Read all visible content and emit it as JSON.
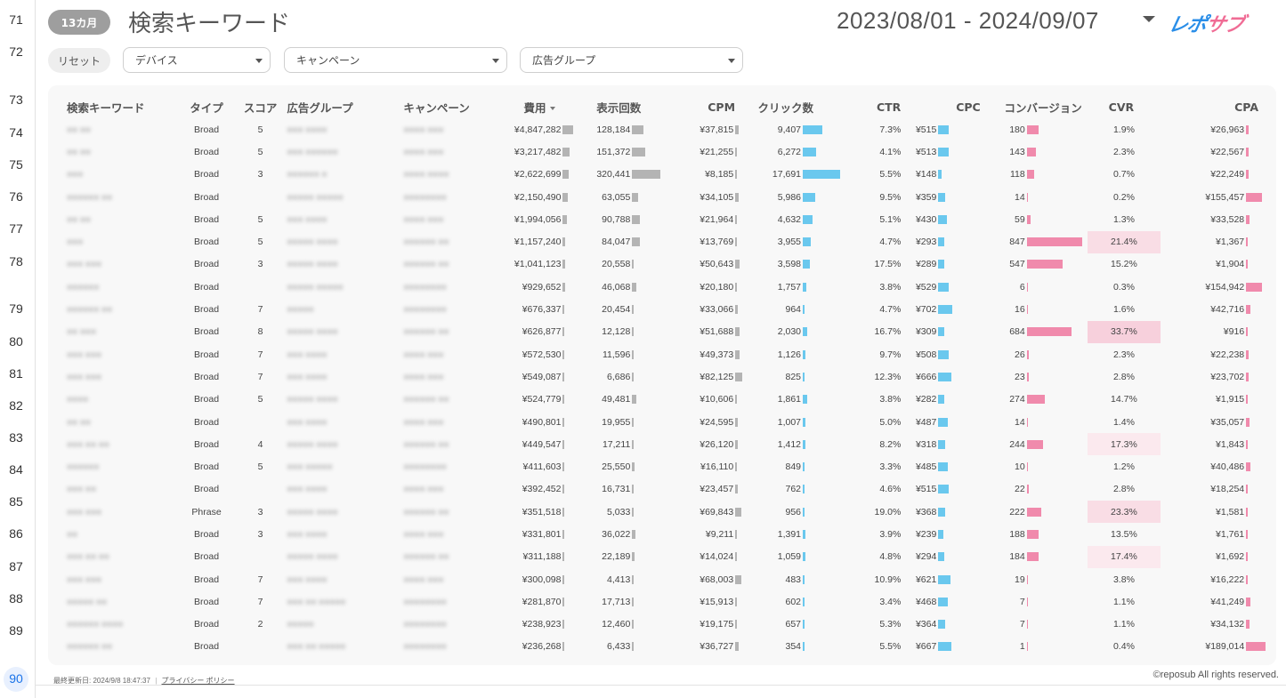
{
  "gutter": {
    "rows": [
      "71",
      "72",
      "73",
      "74",
      "75",
      "76",
      "77",
      "78",
      "79",
      "80",
      "81",
      "82",
      "83",
      "84",
      "85",
      "86",
      "87",
      "88",
      "89",
      "90"
    ],
    "active_row": "90"
  },
  "header": {
    "period_label": "13カ月",
    "title": "検索キーワード",
    "date_range": "2023/08/01 - 2024/09/07",
    "logo_text_main": "レポ",
    "logo_text_accent": "サブ"
  },
  "filters": {
    "reset_label": "リセット",
    "device_label": "デバイス",
    "campaign_label": "キャンペーン",
    "adgroup_label": "広告グループ"
  },
  "table": {
    "columns": [
      "検索キーワード",
      "タイプ",
      "スコア",
      "広告グループ",
      "キャンペーン",
      "費用",
      "表示回数",
      "CPM",
      "クリック数",
      "CTR",
      "CPC",
      "コンバージョン",
      "CVR",
      "CPA"
    ],
    "sort_column": "費用",
    "rows": [
      {
        "kw": "■■ ■■",
        "type": "Broad",
        "score": "5",
        "ag": "■■■ ■■■■",
        "camp": "■■■■ ■■■",
        "cost": "¥4,847,282",
        "cost_r": 1.0,
        "imp": "128,184",
        "imp_r": 0.4,
        "cpm": "¥37,815",
        "cpm_r": 0.46,
        "clk": "9,407",
        "clk_r": 0.53,
        "ctr": "7.3%",
        "cpc": "¥515",
        "cpc_r": 0.72,
        "cv": "180",
        "cv_r": 0.21,
        "cvr": "1.9%",
        "cvr_level": 0,
        "cpa": "¥26,963",
        "cpa_r": 0.14
      },
      {
        "kw": "■■ ■■",
        "type": "Broad",
        "score": "5",
        "ag": "■■■ ■■■■■■",
        "camp": "■■■■ ■■■",
        "cost": "¥3,217,482",
        "cost_r": 0.66,
        "imp": "151,372",
        "imp_r": 0.47,
        "cpm": "¥21,255",
        "cpm_r": 0.26,
        "clk": "6,272",
        "clk_r": 0.35,
        "ctr": "4.1%",
        "cpc": "¥513",
        "cpc_r": 0.72,
        "cv": "143",
        "cv_r": 0.17,
        "cvr": "2.3%",
        "cvr_level": 0,
        "cpa": "¥22,567",
        "cpa_r": 0.12
      },
      {
        "kw": "■■■",
        "type": "Broad",
        "score": "3",
        "ag": "■■■■■■ ■",
        "camp": "■■■■ ■■■■",
        "cost": "¥2,622,699",
        "cost_r": 0.54,
        "imp": "320,441",
        "imp_r": 1.0,
        "cpm": "¥8,185",
        "cpm_r": 0.1,
        "clk": "17,691",
        "clk_r": 1.0,
        "ctr": "5.5%",
        "cpc": "¥148",
        "cpc_r": 0.21,
        "cv": "118",
        "cv_r": 0.14,
        "cvr": "0.7%",
        "cvr_level": 0,
        "cpa": "¥22,249",
        "cpa_r": 0.12
      },
      {
        "kw": "■■■■■■ ■■",
        "type": "Broad",
        "score": "",
        "ag": "■■■■■ ■■■■■",
        "camp": "■■■■■■■■",
        "cost": "¥2,150,490",
        "cost_r": 0.44,
        "imp": "63,055",
        "imp_r": 0.2,
        "cpm": "¥34,105",
        "cpm_r": 0.42,
        "clk": "5,986",
        "clk_r": 0.34,
        "ctr": "9.5%",
        "cpc": "¥359",
        "cpc_r": 0.5,
        "cv": "14",
        "cv_r": 0.02,
        "cvr": "0.2%",
        "cvr_level": 0,
        "cpa": "¥155,457",
        "cpa_r": 0.82
      },
      {
        "kw": "■■ ■■",
        "type": "Broad",
        "score": "5",
        "ag": "■■■ ■■■■",
        "camp": "■■■■ ■■■",
        "cost": "¥1,994,056",
        "cost_r": 0.41,
        "imp": "90,788",
        "imp_r": 0.28,
        "cpm": "¥21,964",
        "cpm_r": 0.27,
        "clk": "4,632",
        "clk_r": 0.26,
        "ctr": "5.1%",
        "cpc": "¥430",
        "cpc_r": 0.6,
        "cv": "59",
        "cv_r": 0.07,
        "cvr": "1.3%",
        "cvr_level": 0,
        "cpa": "¥33,528",
        "cpa_r": 0.18
      },
      {
        "kw": "■■■",
        "type": "Broad",
        "score": "5",
        "ag": "■■■■■ ■■■■",
        "camp": "■■■■■■ ■■",
        "cost": "¥1,157,240",
        "cost_r": 0.24,
        "imp": "84,047",
        "imp_r": 0.26,
        "cpm": "¥13,769",
        "cpm_r": 0.17,
        "clk": "3,955",
        "clk_r": 0.22,
        "ctr": "4.7%",
        "cpc": "¥293",
        "cpc_r": 0.41,
        "cv": "847",
        "cv_r": 1.0,
        "cvr": "21.4%",
        "cvr_level": 2,
        "cpa": "¥1,367",
        "cpa_r": 0.01
      },
      {
        "kw": "■■■ ■■■",
        "type": "Broad",
        "score": "3",
        "ag": "■■■■■ ■■■■",
        "camp": "■■■■■■ ■■",
        "cost": "¥1,041,123",
        "cost_r": 0.21,
        "imp": "20,558",
        "imp_r": 0.06,
        "cpm": "¥50,643",
        "cpm_r": 0.62,
        "clk": "3,598",
        "clk_r": 0.2,
        "ctr": "17.5%",
        "cpc": "¥289",
        "cpc_r": 0.41,
        "cv": "547",
        "cv_r": 0.65,
        "cvr": "15.2%",
        "cvr_level": 0,
        "cpa": "¥1,904",
        "cpa_r": 0.01
      },
      {
        "kw": "■■■■■■",
        "type": "Broad",
        "score": "",
        "ag": "■■■■■ ■■■■■",
        "camp": "■■■■■■■■",
        "cost": "¥929,652",
        "cost_r": 0.19,
        "imp": "46,068",
        "imp_r": 0.14,
        "cpm": "¥20,180",
        "cpm_r": 0.25,
        "clk": "1,757",
        "clk_r": 0.1,
        "ctr": "3.8%",
        "cpc": "¥529",
        "cpc_r": 0.74,
        "cv": "6",
        "cv_r": 0.01,
        "cvr": "0.3%",
        "cvr_level": 0,
        "cpa": "¥154,942",
        "cpa_r": 0.82
      },
      {
        "kw": "■■■■■■ ■■",
        "type": "Broad",
        "score": "7",
        "ag": "■■■■■",
        "camp": "■■■■■■■■",
        "cost": "¥676,337",
        "cost_r": 0.14,
        "imp": "20,454",
        "imp_r": 0.06,
        "cpm": "¥33,066",
        "cpm_r": 0.4,
        "clk": "964",
        "clk_r": 0.05,
        "ctr": "4.7%",
        "cpc": "¥702",
        "cpc_r": 0.98,
        "cv": "16",
        "cv_r": 0.02,
        "cvr": "1.6%",
        "cvr_level": 0,
        "cpa": "¥42,716",
        "cpa_r": 0.23
      },
      {
        "kw": "■■ ■■■",
        "type": "Broad",
        "score": "8",
        "ag": "■■■■■ ■■■■",
        "camp": "■■■■■■ ■■",
        "cost": "¥626,877",
        "cost_r": 0.13,
        "imp": "12,128",
        "imp_r": 0.04,
        "cpm": "¥51,688",
        "cpm_r": 0.63,
        "clk": "2,030",
        "clk_r": 0.11,
        "ctr": "16.7%",
        "cpc": "¥309",
        "cpc_r": 0.43,
        "cv": "684",
        "cv_r": 0.81,
        "cvr": "33.7%",
        "cvr_level": 3,
        "cpa": "¥916",
        "cpa_r": 0.0
      },
      {
        "kw": "■■■ ■■■",
        "type": "Broad",
        "score": "7",
        "ag": "■■■ ■■■■",
        "camp": "■■■■ ■■■",
        "cost": "¥572,530",
        "cost_r": 0.12,
        "imp": "11,596",
        "imp_r": 0.04,
        "cpm": "¥49,373",
        "cpm_r": 0.6,
        "clk": "1,126",
        "clk_r": 0.06,
        "ctr": "9.7%",
        "cpc": "¥508",
        "cpc_r": 0.71,
        "cv": "26",
        "cv_r": 0.03,
        "cvr": "2.3%",
        "cvr_level": 0,
        "cpa": "¥22,238",
        "cpa_r": 0.12
      },
      {
        "kw": "■■■ ■■■",
        "type": "Broad",
        "score": "7",
        "ag": "■■■ ■■■■",
        "camp": "■■■■ ■■■",
        "cost": "¥549,087",
        "cost_r": 0.11,
        "imp": "6,686",
        "imp_r": 0.02,
        "cpm": "¥82,125",
        "cpm_r": 1.0,
        "clk": "825",
        "clk_r": 0.05,
        "ctr": "12.3%",
        "cpc": "¥666",
        "cpc_r": 0.93,
        "cv": "23",
        "cv_r": 0.03,
        "cvr": "2.8%",
        "cvr_level": 0,
        "cpa": "¥23,702",
        "cpa_r": 0.13
      },
      {
        "kw": "■■■■",
        "type": "Broad",
        "score": "5",
        "ag": "■■■■■ ■■■■",
        "camp": "■■■■■■ ■■",
        "cost": "¥524,779",
        "cost_r": 0.11,
        "imp": "49,481",
        "imp_r": 0.15,
        "cpm": "¥10,606",
        "cpm_r": 0.13,
        "clk": "1,861",
        "clk_r": 0.11,
        "ctr": "3.8%",
        "cpc": "¥282",
        "cpc_r": 0.39,
        "cv": "274",
        "cv_r": 0.32,
        "cvr": "14.7%",
        "cvr_level": 0,
        "cpa": "¥1,915",
        "cpa_r": 0.01
      },
      {
        "kw": "■■ ■■",
        "type": "Broad",
        "score": "",
        "ag": "■■■ ■■■■",
        "camp": "■■■■ ■■■",
        "cost": "¥490,801",
        "cost_r": 0.1,
        "imp": "19,955",
        "imp_r": 0.06,
        "cpm": "¥24,595",
        "cpm_r": 0.3,
        "clk": "1,007",
        "clk_r": 0.06,
        "ctr": "5.0%",
        "cpc": "¥487",
        "cpc_r": 0.68,
        "cv": "14",
        "cv_r": 0.02,
        "cvr": "1.4%",
        "cvr_level": 0,
        "cpa": "¥35,057",
        "cpa_r": 0.18
      },
      {
        "kw": "■■■ ■■ ■■",
        "type": "Broad",
        "score": "4",
        "ag": "■■■■■ ■■■■",
        "camp": "■■■■■■ ■■",
        "cost": "¥449,547",
        "cost_r": 0.09,
        "imp": "17,211",
        "imp_r": 0.05,
        "cpm": "¥26,120",
        "cpm_r": 0.32,
        "clk": "1,412",
        "clk_r": 0.08,
        "ctr": "8.2%",
        "cpc": "¥318",
        "cpc_r": 0.45,
        "cv": "244",
        "cv_r": 0.29,
        "cvr": "17.3%",
        "cvr_level": 1,
        "cpa": "¥1,843",
        "cpa_r": 0.01
      },
      {
        "kw": "■■■■■■",
        "type": "Broad",
        "score": "5",
        "ag": "■■■ ■■■■■",
        "camp": "■■■■■■■■",
        "cost": "¥411,603",
        "cost_r": 0.08,
        "imp": "25,550",
        "imp_r": 0.08,
        "cpm": "¥16,110",
        "cpm_r": 0.2,
        "clk": "849",
        "clk_r": 0.05,
        "ctr": "3.3%",
        "cpc": "¥485",
        "cpc_r": 0.68,
        "cv": "10",
        "cv_r": 0.01,
        "cvr": "1.2%",
        "cvr_level": 0,
        "cpa": "¥40,486",
        "cpa_r": 0.21
      },
      {
        "kw": "■■■ ■■",
        "type": "Broad",
        "score": "",
        "ag": "■■■ ■■■■",
        "camp": "■■■■ ■■■",
        "cost": "¥392,452",
        "cost_r": 0.08,
        "imp": "16,731",
        "imp_r": 0.05,
        "cpm": "¥23,457",
        "cpm_r": 0.29,
        "clk": "762",
        "clk_r": 0.04,
        "ctr": "4.6%",
        "cpc": "¥515",
        "cpc_r": 0.72,
        "cv": "22",
        "cv_r": 0.03,
        "cvr": "2.8%",
        "cvr_level": 0,
        "cpa": "¥18,254",
        "cpa_r": 0.1
      },
      {
        "kw": "■■■ ■■■",
        "type": "Phrase",
        "score": "3",
        "ag": "■■■■■ ■■■■",
        "camp": "■■■■■■ ■■",
        "cost": "¥351,518",
        "cost_r": 0.07,
        "imp": "5,033",
        "imp_r": 0.02,
        "cpm": "¥69,843",
        "cpm_r": 0.85,
        "clk": "956",
        "clk_r": 0.05,
        "ctr": "19.0%",
        "cpc": "¥368",
        "cpc_r": 0.51,
        "cv": "222",
        "cv_r": 0.26,
        "cvr": "23.3%",
        "cvr_level": 2,
        "cpa": "¥1,581",
        "cpa_r": 0.01
      },
      {
        "kw": "■■",
        "type": "Broad",
        "score": "3",
        "ag": "■■■ ■■■■",
        "camp": "■■■■ ■■■",
        "cost": "¥331,801",
        "cost_r": 0.07,
        "imp": "36,022",
        "imp_r": 0.11,
        "cpm": "¥9,211",
        "cpm_r": 0.11,
        "clk": "1,391",
        "clk_r": 0.08,
        "ctr": "3.9%",
        "cpc": "¥239",
        "cpc_r": 0.33,
        "cv": "188",
        "cv_r": 0.22,
        "cvr": "13.5%",
        "cvr_level": 0,
        "cpa": "¥1,761",
        "cpa_r": 0.01
      },
      {
        "kw": "■■■ ■■ ■■",
        "type": "Broad",
        "score": "",
        "ag": "■■■■■ ■■■■",
        "camp": "■■■■■■ ■■",
        "cost": "¥311,188",
        "cost_r": 0.06,
        "imp": "22,189",
        "imp_r": 0.07,
        "cpm": "¥14,024",
        "cpm_r": 0.17,
        "clk": "1,059",
        "clk_r": 0.06,
        "ctr": "4.8%",
        "cpc": "¥294",
        "cpc_r": 0.41,
        "cv": "184",
        "cv_r": 0.22,
        "cvr": "17.4%",
        "cvr_level": 1,
        "cpa": "¥1,692",
        "cpa_r": 0.01
      },
      {
        "kw": "■■■ ■■■",
        "type": "Broad",
        "score": "7",
        "ag": "■■■ ■■■■",
        "camp": "■■■■ ■■■",
        "cost": "¥300,098",
        "cost_r": 0.06,
        "imp": "4,413",
        "imp_r": 0.01,
        "cpm": "¥68,003",
        "cpm_r": 0.83,
        "clk": "483",
        "clk_r": 0.03,
        "ctr": "10.9%",
        "cpc": "¥621",
        "cpc_r": 0.87,
        "cv": "19",
        "cv_r": 0.02,
        "cvr": "3.8%",
        "cvr_level": 0,
        "cpa": "¥16,222",
        "cpa_r": 0.09
      },
      {
        "kw": "■■■■■ ■■",
        "type": "Broad",
        "score": "7",
        "ag": "■■■ ■■ ■■■■■",
        "camp": "■■■■■■■■",
        "cost": "¥281,870",
        "cost_r": 0.06,
        "imp": "17,713",
        "imp_r": 0.06,
        "cpm": "¥15,913",
        "cpm_r": 0.19,
        "clk": "602",
        "clk_r": 0.03,
        "ctr": "3.4%",
        "cpc": "¥468",
        "cpc_r": 0.66,
        "cv": "7",
        "cv_r": 0.01,
        "cvr": "1.1%",
        "cvr_level": 0,
        "cpa": "¥41,249",
        "cpa_r": 0.22
      },
      {
        "kw": "■■■■■■ ■■■■",
        "type": "Broad",
        "score": "2",
        "ag": "■■■■■",
        "camp": "■■■■■■■■",
        "cost": "¥238,923",
        "cost_r": 0.05,
        "imp": "12,460",
        "imp_r": 0.04,
        "cpm": "¥19,175",
        "cpm_r": 0.23,
        "clk": "657",
        "clk_r": 0.04,
        "ctr": "5.3%",
        "cpc": "¥364",
        "cpc_r": 0.51,
        "cv": "7",
        "cv_r": 0.01,
        "cvr": "1.1%",
        "cvr_level": 0,
        "cpa": "¥34,132",
        "cpa_r": 0.18
      },
      {
        "kw": "■■■■■■ ■■",
        "type": "Broad",
        "score": "",
        "ag": "■■■ ■■ ■■■■■",
        "camp": "■■■■■■■■",
        "cost": "¥236,268",
        "cost_r": 0.05,
        "imp": "6,433",
        "imp_r": 0.02,
        "cpm": "¥36,727",
        "cpm_r": 0.45,
        "clk": "354",
        "clk_r": 0.02,
        "ctr": "5.5%",
        "cpc": "¥667",
        "cpc_r": 0.94,
        "cv": "1",
        "cv_r": 0.0,
        "cvr": "0.4%",
        "cvr_level": 0,
        "cpa": "¥189,014",
        "cpa_r": 1.0
      }
    ]
  },
  "footer": {
    "updated": "最終更新日: 2024/9/8 18:47:37",
    "separator": "|",
    "privacy_link": "プライバシー ポリシー",
    "copyright": "©reposub All rights reserved."
  },
  "colors": {
    "grey_bar": "#b4b4b4",
    "blue_bar": "#6ac8ee",
    "pink_bar": "#f08aac",
    "cvr_heat": [
      "#f8f8f8",
      "#fbe9ee",
      "#f9dde5",
      "#f7d0dc"
    ]
  }
}
